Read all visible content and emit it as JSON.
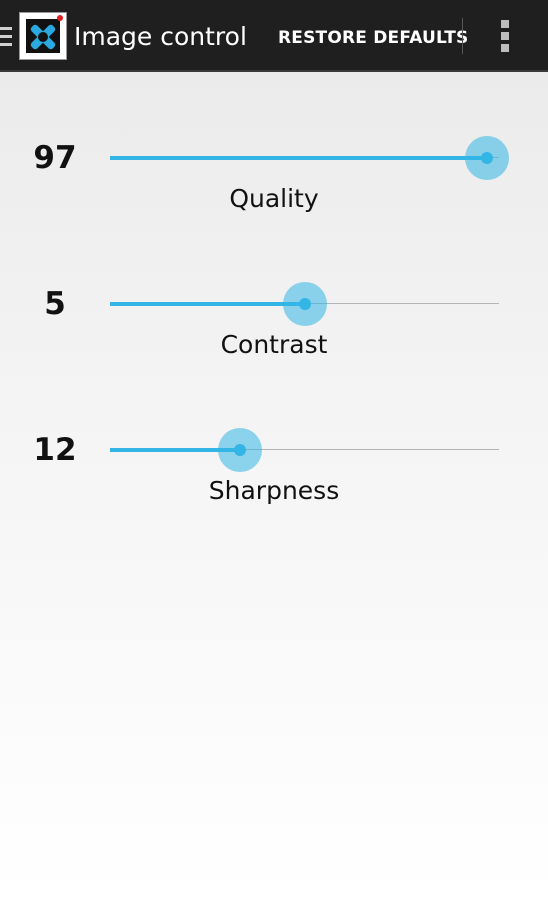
{
  "action_bar": {
    "title": "Image control",
    "restore_label": "RESTORE DEFAULTS",
    "icons": {
      "drawer": "menu-drawer-icon",
      "logo": "app-logo-icon",
      "overflow": "overflow-menu-icon"
    },
    "background": "#1f1f1f"
  },
  "controls": [
    {
      "name": "Quality",
      "value": "97",
      "level": 97,
      "max": 100
    },
    {
      "name": "Contrast",
      "value": "5",
      "level": 5,
      "max": 10
    },
    {
      "name": "Sharpness",
      "value": "12",
      "level": 12,
      "max": 36
    }
  ],
  "colors": {
    "accent": "#33b5e5",
    "track": "#b5b5b5"
  }
}
